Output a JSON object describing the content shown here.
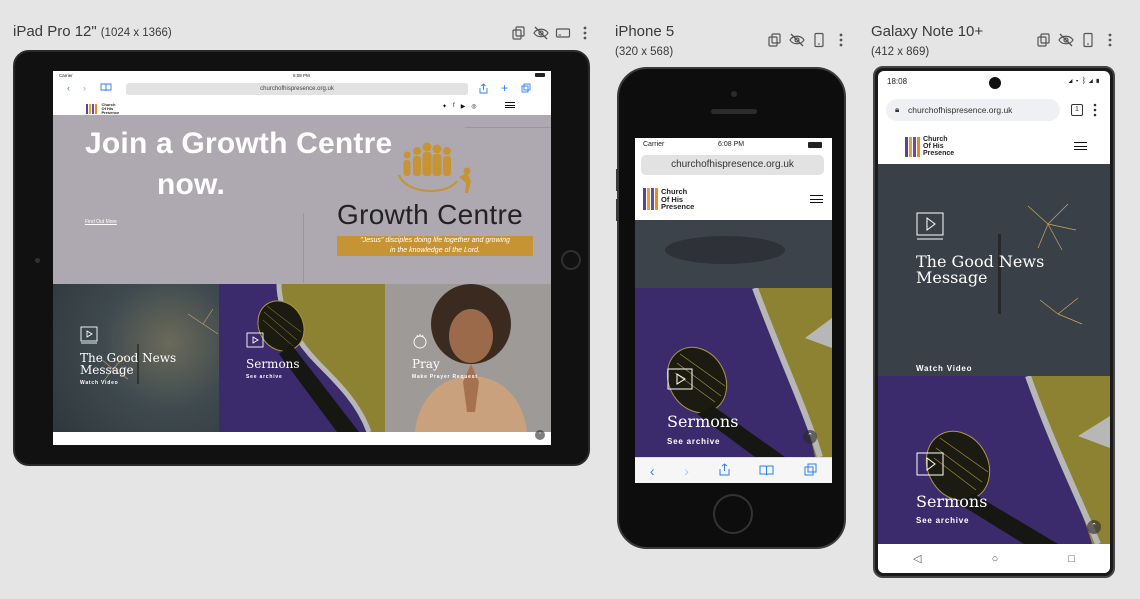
{
  "devices": {
    "ipad": {
      "name": "iPad Pro 12\"",
      "dims": "(1024 x 1366)"
    },
    "iphone": {
      "name": "iPhone 5",
      "dims": "(320 x 568)"
    },
    "galaxy": {
      "name": "Galaxy Note 10+",
      "dims": "(412 x 869)"
    }
  },
  "ipad": {
    "status_left": "Carrier",
    "status_time": "6:08 PM",
    "url": "churchofhispresence.org.uk",
    "logo": "Church Of His Presence",
    "hero": {
      "title_line1": "Join a Growth Centre",
      "title_line2": "now.",
      "link": "Find Out More",
      "gc_title": "Growth Centre",
      "gc_tag_line1": "\"Jesus\" disciples doing life together and growing",
      "gc_tag_line2": "in the knowledge of the Lord."
    },
    "tiles": [
      {
        "title": "The Good News Message",
        "sub": "Watch Video"
      },
      {
        "title": "Sermons",
        "sub": "See archive"
      },
      {
        "title": "Pray",
        "sub": "Make Prayer Request"
      }
    ]
  },
  "iphone": {
    "status_left": "Carrier",
    "status_time": "6:08 PM",
    "url": "churchofhispresence.org.uk",
    "logo_l1": "Church",
    "logo_l2": "Of His",
    "logo_l3": "Presence",
    "tile_title": "Sermons",
    "tile_sub": "See archive"
  },
  "galaxy": {
    "status_time": "18:08",
    "url": "churchofhispresence.org.uk",
    "tab_count": "1",
    "logo_l1": "Church",
    "logo_l2": "Of His",
    "logo_l3": "Presence",
    "hero_title": "The Good News Message",
    "hero_sub": "Watch Video",
    "tile_title": "Sermons",
    "tile_sub": "See archive"
  },
  "colors": {
    "accent_gold": "#c69434",
    "purple": "#3c2b6c",
    "olive": "#8c8232",
    "ios_blue": "#2c7df7"
  }
}
